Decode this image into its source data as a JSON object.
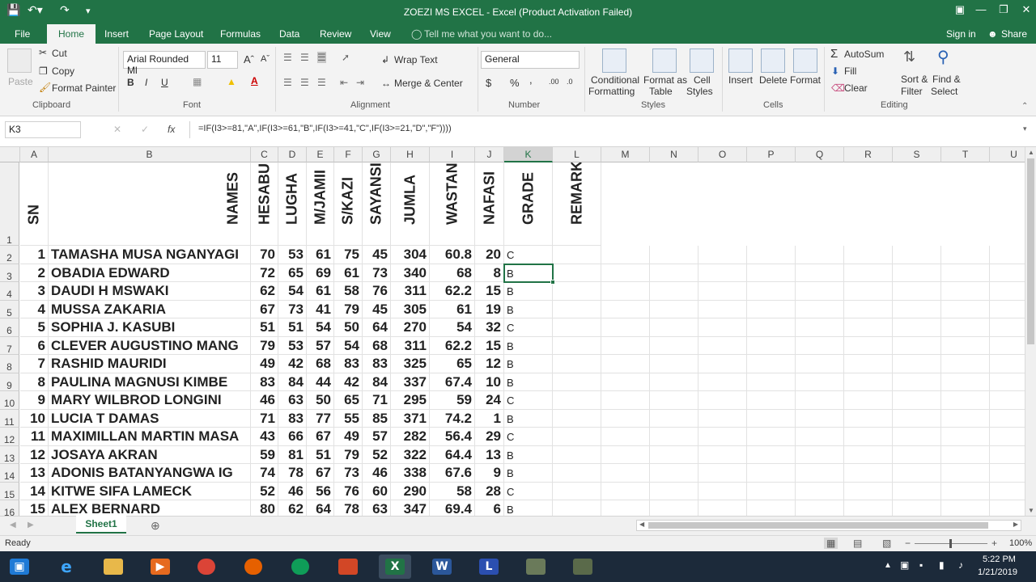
{
  "window": {
    "title": "ZOEZI MS EXCEL - Excel (Product Activation Failed)"
  },
  "quick_access": {
    "save_icon": "save-icon",
    "undo_icon": "undo-icon",
    "redo_icon": "redo-icon",
    "customize_icon": "customize-qat-icon"
  },
  "window_buttons": {
    "restore_ribbon": "ribbon-display-icon",
    "minimize": "minimize-icon",
    "maximize": "maximize-icon",
    "close": "close-icon"
  },
  "tabs": [
    {
      "label": "File"
    },
    {
      "label": "Home",
      "active": true
    },
    {
      "label": "Insert"
    },
    {
      "label": "Page Layout"
    },
    {
      "label": "Formulas"
    },
    {
      "label": "Data"
    },
    {
      "label": "Review"
    },
    {
      "label": "View"
    }
  ],
  "tell_me": "Tell me what you want to do...",
  "sign_in": "Sign in",
  "share": "Share",
  "ribbon": {
    "clipboard": {
      "paste": "Paste",
      "cut": "Cut",
      "copy": "Copy",
      "format_painter": "Format Painter",
      "group": "Clipboard"
    },
    "font": {
      "name": "Arial Rounded Ml",
      "size": "11",
      "bold": "B",
      "italic": "I",
      "underline": "U",
      "group": "Font"
    },
    "alignment": {
      "wrap_text": "Wrap Text",
      "merge_center": "Merge & Center",
      "group": "Alignment"
    },
    "number": {
      "format": "General",
      "currency": "$",
      "percent": "%",
      "comma": ",",
      "inc_decimal": ".00",
      "dec_decimal": ".0",
      "group": "Number"
    },
    "styles": {
      "conditional_1": "Conditional",
      "conditional_2": "Formatting",
      "format_table_1": "Format as",
      "format_table_2": "Table",
      "cell_styles_1": "Cell",
      "cell_styles_2": "Styles",
      "group": "Styles"
    },
    "cells": {
      "insert": "Insert",
      "delete": "Delete",
      "format": "Format",
      "group": "Cells"
    },
    "editing": {
      "autosum": "AutoSum",
      "fill": "Fill",
      "clear": "Clear",
      "sort_1": "Sort &",
      "sort_2": "Filter",
      "find_1": "Find &",
      "find_2": "Select",
      "group": "Editing"
    }
  },
  "formula_bar": {
    "name_box": "K3",
    "fx": "fx",
    "formula": "=IF(I3>=81,\"A\",IF(I3>=61,\"B\",IF(I3>=41,\"C\",IF(I3>=21,\"D\",\"F\"))))"
  },
  "columns": [
    "A",
    "B",
    "C",
    "D",
    "E",
    "F",
    "G",
    "H",
    "I",
    "J",
    "K",
    "L",
    "M",
    "N",
    "O",
    "P",
    "Q",
    "R",
    "S",
    "T",
    "U"
  ],
  "headers": [
    "SN",
    "NAMES",
    "HESABU",
    "LUGHA",
    "M/JAMII",
    "S/KAZI",
    "SAYANSI",
    "JUMLA",
    "WASTANI",
    "NAFASI",
    "GRADE",
    "REMARKS"
  ],
  "rows": [
    {
      "r": "2",
      "sn": "1",
      "name": "TAMASHA MUSA NGANYAGI",
      "c": "70",
      "d": "53",
      "e": "61",
      "f": "75",
      "g": "45",
      "h": "304",
      "i": "60.8",
      "j": "20",
      "k": "C"
    },
    {
      "r": "3",
      "sn": "2",
      "name": "OBADIA EDWARD",
      "c": "72",
      "d": "65",
      "e": "69",
      "f": "61",
      "g": "73",
      "h": "340",
      "i": "68",
      "j": "8",
      "k": "B"
    },
    {
      "r": "4",
      "sn": "3",
      "name": "DAUDI H MSWAKI",
      "c": "62",
      "d": "54",
      "e": "61",
      "f": "58",
      "g": "76",
      "h": "311",
      "i": "62.2",
      "j": "15",
      "k": "B"
    },
    {
      "r": "5",
      "sn": "4",
      "name": "MUSSA ZAKARIA",
      "c": "67",
      "d": "73",
      "e": "41",
      "f": "79",
      "g": "45",
      "h": "305",
      "i": "61",
      "j": "19",
      "k": "B"
    },
    {
      "r": "6",
      "sn": "5",
      "name": "SOPHIA J. KASUBI",
      "c": "51",
      "d": "51",
      "e": "54",
      "f": "50",
      "g": "64",
      "h": "270",
      "i": "54",
      "j": "32",
      "k": "C"
    },
    {
      "r": "7",
      "sn": "6",
      "name": "CLEVER AUGUSTINO MANG",
      "c": "79",
      "d": "53",
      "e": "57",
      "f": "54",
      "g": "68",
      "h": "311",
      "i": "62.2",
      "j": "15",
      "k": "B"
    },
    {
      "r": "8",
      "sn": "7",
      "name": "RASHID MAURIDI",
      "c": "49",
      "d": "42",
      "e": "68",
      "f": "83",
      "g": "83",
      "h": "325",
      "i": "65",
      "j": "12",
      "k": "B"
    },
    {
      "r": "9",
      "sn": "8",
      "name": "PAULINA MAGNUSI KIMBE",
      "c": "83",
      "d": "84",
      "e": "44",
      "f": "42",
      "g": "84",
      "h": "337",
      "i": "67.4",
      "j": "10",
      "k": "B"
    },
    {
      "r": "10",
      "sn": "9",
      "name": "MARY WILBROD LONGINI",
      "c": "46",
      "d": "63",
      "e": "50",
      "f": "65",
      "g": "71",
      "h": "295",
      "i": "59",
      "j": "24",
      "k": "C"
    },
    {
      "r": "11",
      "sn": "10",
      "name": "LUCIA T DAMAS",
      "c": "71",
      "d": "83",
      "e": "77",
      "f": "55",
      "g": "85",
      "h": "371",
      "i": "74.2",
      "j": "1",
      "k": "B"
    },
    {
      "r": "12",
      "sn": "11",
      "name": "MAXIMILLAN MARTIN MASA",
      "c": "43",
      "d": "66",
      "e": "67",
      "f": "49",
      "g": "57",
      "h": "282",
      "i": "56.4",
      "j": "29",
      "k": "C"
    },
    {
      "r": "13",
      "sn": "12",
      "name": "JOSAYA AKRAN",
      "c": "59",
      "d": "81",
      "e": "51",
      "f": "79",
      "g": "52",
      "h": "322",
      "i": "64.4",
      "j": "13",
      "k": "B"
    },
    {
      "r": "14",
      "sn": "13",
      "name": "ADONIS BATANYANGWA IG",
      "c": "74",
      "d": "78",
      "e": "67",
      "f": "73",
      "g": "46",
      "h": "338",
      "i": "67.6",
      "j": "9",
      "k": "B"
    },
    {
      "r": "15",
      "sn": "14",
      "name": "KITWE SIFA LAMECK",
      "c": "52",
      "d": "46",
      "e": "56",
      "f": "76",
      "g": "60",
      "h": "290",
      "i": "58",
      "j": "28",
      "k": "C"
    },
    {
      "r": "16",
      "sn": "15",
      "name": "ALEX BERNARD",
      "c": "80",
      "d": "62",
      "e": "64",
      "f": "78",
      "g": "63",
      "h": "347",
      "i": "69.4",
      "j": "6",
      "k": "B"
    }
  ],
  "sheet_tabs": [
    {
      "label": "Sheet1",
      "active": true
    }
  ],
  "status": {
    "ready": "Ready",
    "zoom": "100%"
  },
  "taskbar": {
    "time": "5:22 PM",
    "date": "1/21/2019"
  },
  "colors": {
    "excel_green": "#217346",
    "ribbon_bg": "#f3f3f3",
    "taskbar": "#1c2a3a"
  }
}
